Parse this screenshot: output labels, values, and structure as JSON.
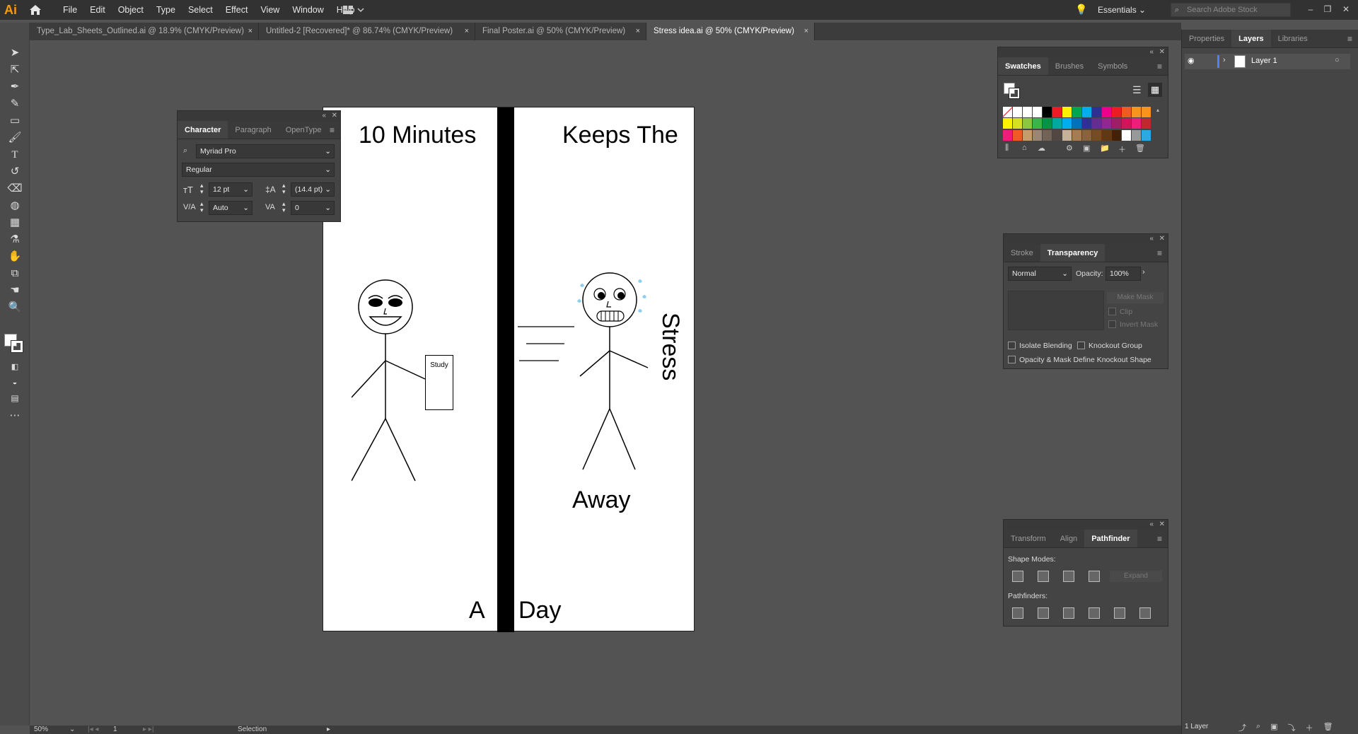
{
  "app": {
    "logo": "Ai"
  },
  "menu": [
    "File",
    "Edit",
    "Object",
    "Type",
    "Select",
    "Effect",
    "View",
    "Window",
    "Help"
  ],
  "workspace": "Essentials",
  "search": {
    "placeholder": "Search Adobe Stock"
  },
  "tabs": [
    {
      "label": "Type_Lab_Sheets_Outlined.ai @ 18.9% (CMYK/Preview)",
      "close": "×"
    },
    {
      "label": "Untitled-2 [Recovered]* @ 86.74% (CMYK/Preview)",
      "close": "×"
    },
    {
      "label": "Final Poster.ai @ 50% (CMYK/Preview)",
      "close": "×"
    },
    {
      "label": "Stress idea.ai @ 50% (CMYK/Preview)",
      "close": "×"
    }
  ],
  "artboard": {
    "left_title": "10 Minutes",
    "right_title": "Keeps The",
    "sign": "Study",
    "stress": "Stress",
    "away": "Away",
    "a": "A",
    "day": "Day"
  },
  "character_panel": {
    "tabs": [
      "Character",
      "Paragraph",
      "OpenType"
    ],
    "font_family": "Myriad Pro",
    "font_style": "Regular",
    "font_size": "12 pt",
    "leading": "(14.4 pt)",
    "kerning": "Auto",
    "tracking": "0"
  },
  "swatches_panel": {
    "tabs": [
      "Swatches",
      "Brushes",
      "Symbols"
    ]
  },
  "transparency_panel": {
    "tabs": [
      "Stroke",
      "Transparency"
    ],
    "blend_mode": "Normal",
    "opacity_label": "Opacity:",
    "opacity": "100%",
    "make_mask": "Make Mask",
    "clip": "Clip",
    "invert_mask": "Invert Mask",
    "isolate_blending": "Isolate Blending",
    "knockout_group": "Knockout Group",
    "opacity_mask": "Opacity & Mask Define Knockout Shape"
  },
  "pathfinder_panel": {
    "tabs": [
      "Transform",
      "Align",
      "Pathfinder"
    ],
    "shape_modes": "Shape Modes:",
    "expand": "Expand",
    "pathfinders": "Pathfinders:"
  },
  "right_dock": {
    "tabs": [
      "Properties",
      "Layers",
      "Libraries"
    ],
    "layer_name": "Layer 1",
    "layer_count": "1 Layer"
  },
  "status": {
    "zoom": "50%",
    "page": "1",
    "tool": "Selection"
  },
  "swatch_colors": [
    "#ffffff",
    "#ffffff",
    "#ffffff",
    "#ffffff",
    "#000000",
    "#ed1c24",
    "#fff200",
    "#00a651",
    "#00aeef",
    "#2e3192",
    "#ec008c",
    "#ed1c24",
    "#f15a24",
    "#f7941d",
    "#f7941d",
    "#fff200",
    "#d7df23",
    "#8dc63f",
    "#39b54a",
    "#009444",
    "#00a99d",
    "#00aeef",
    "#0072bc",
    "#2e3192",
    "#662d91",
    "#92278f",
    "#9e1f63",
    "#d4145a",
    "#ed1e79",
    "#c1272d",
    "#ed1e79",
    "#f15a24",
    "#c69c6d",
    "#998675",
    "#736357",
    "#534741",
    "#c7b299",
    "#a67c52",
    "#8c6239",
    "#754c24",
    "#603813",
    "#42210b",
    "#ffffff",
    "#999999",
    "#29abe2"
  ]
}
